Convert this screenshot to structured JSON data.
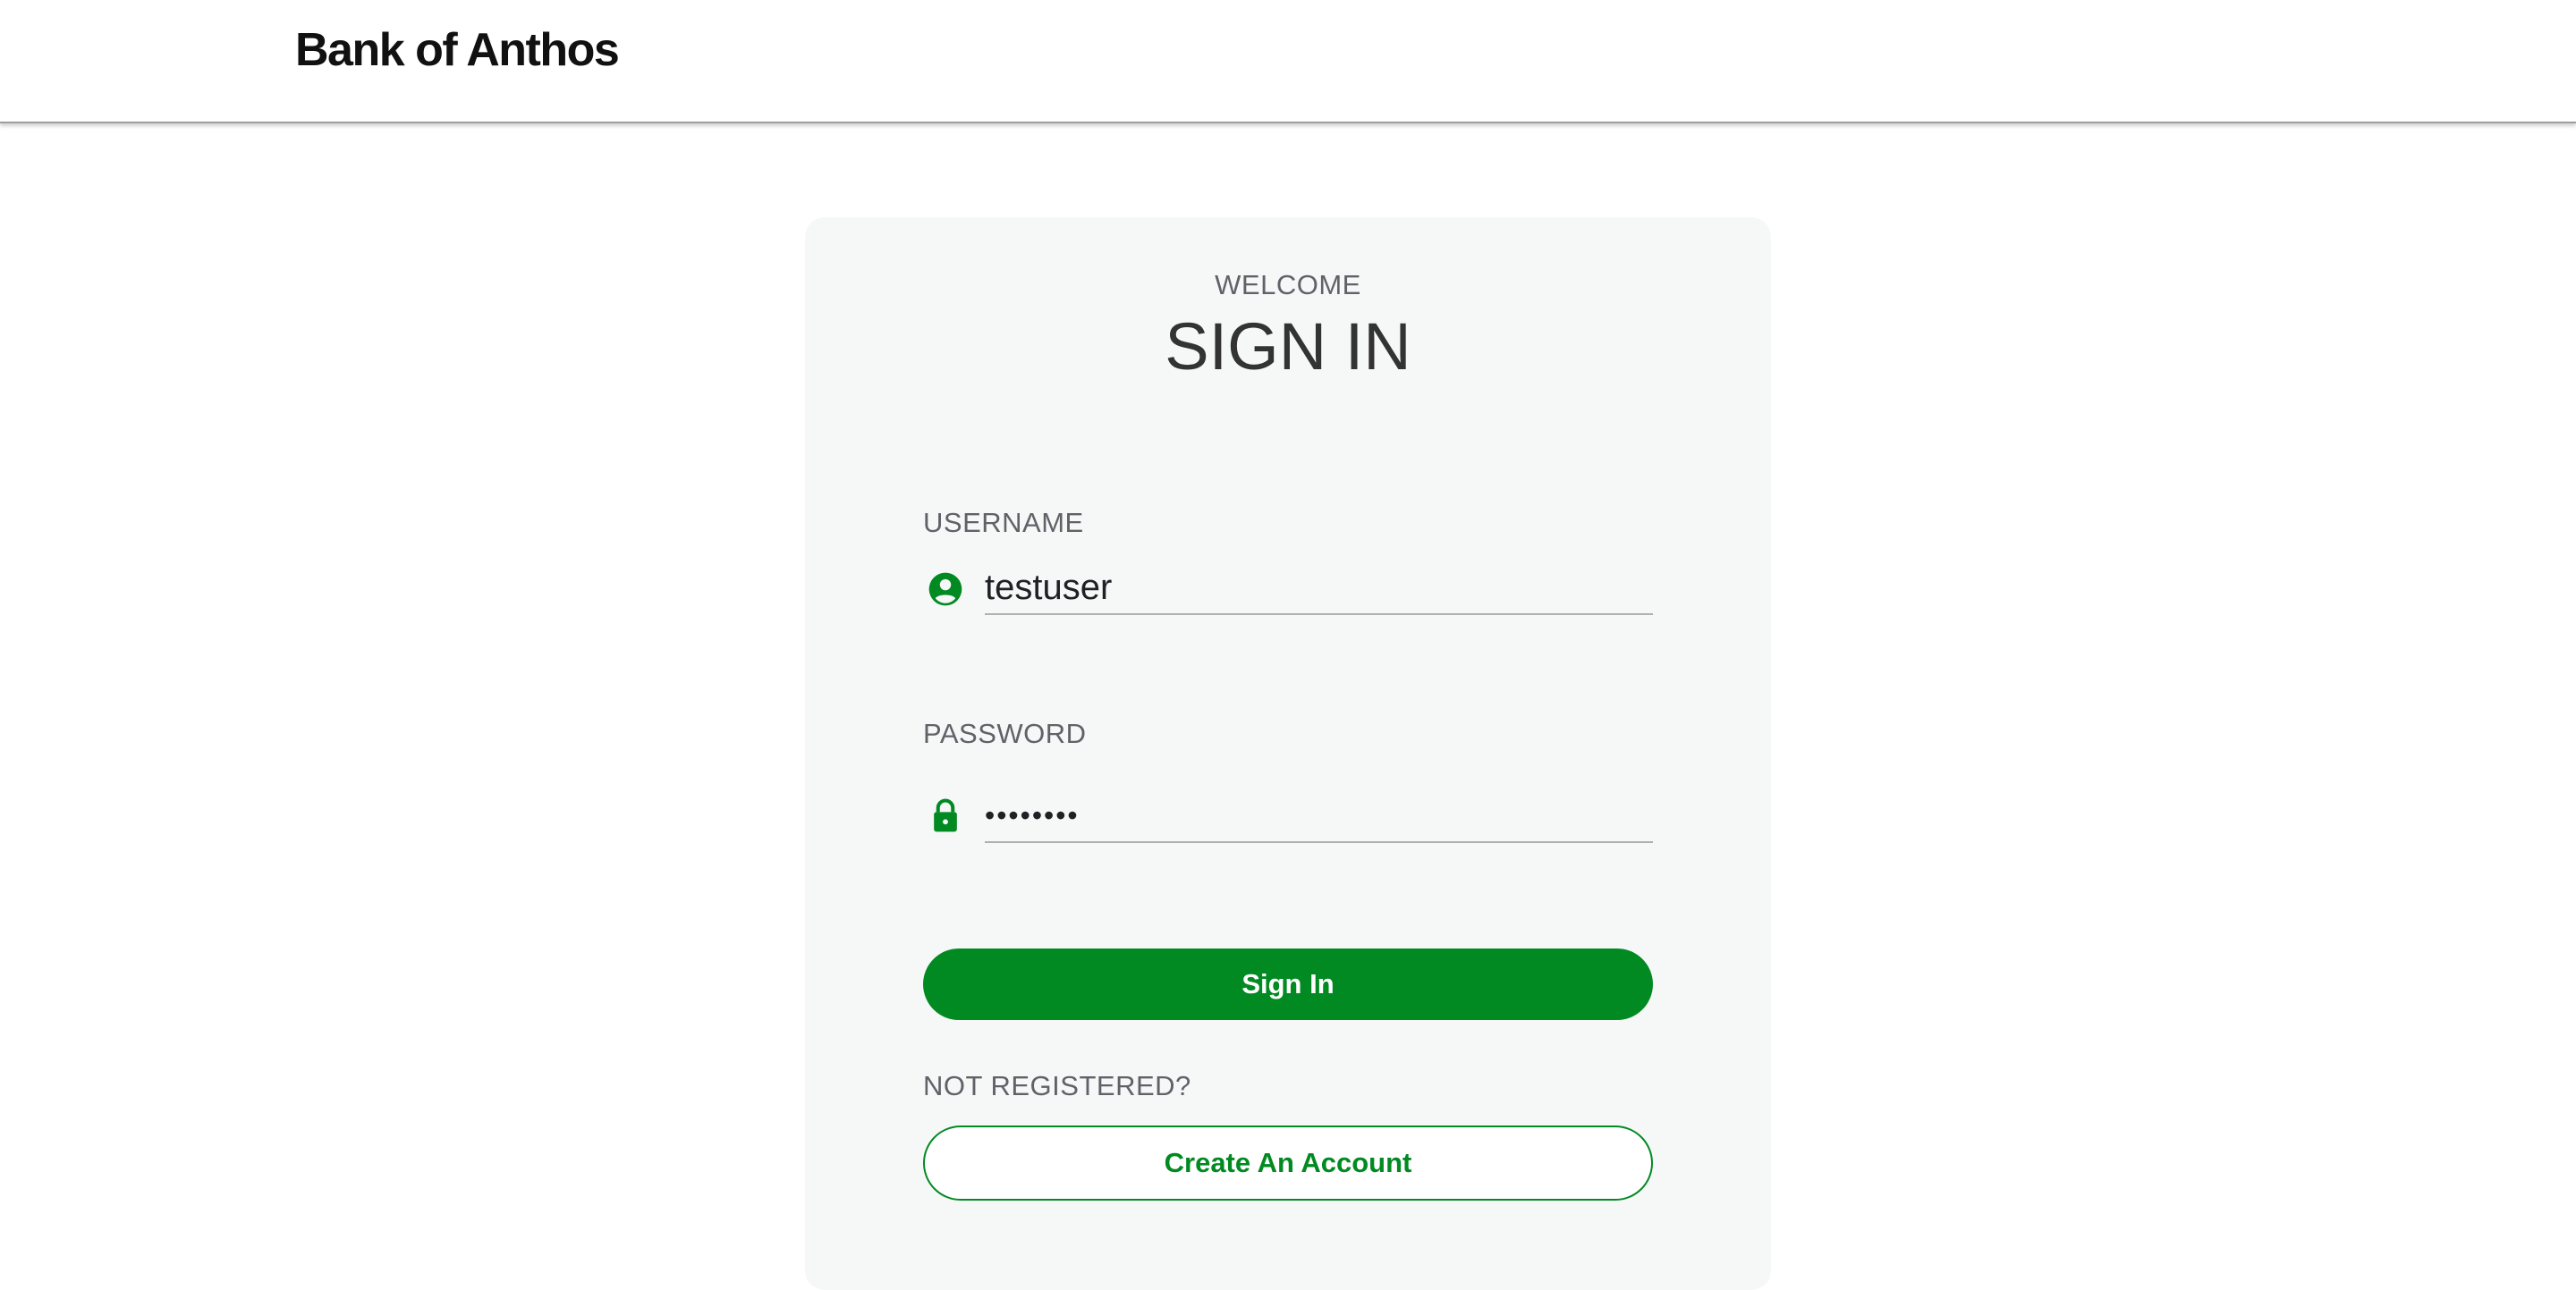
{
  "header": {
    "brand": "Bank of Anthos"
  },
  "login": {
    "welcome": "WELCOME",
    "title": "SIGN IN",
    "username": {
      "label": "USERNAME",
      "value": "testuser",
      "icon": "account-circle-icon"
    },
    "password": {
      "label": "PASSWORD",
      "value": "password",
      "icon": "lock-icon"
    },
    "signin_button": "Sign In",
    "not_registered": "NOT REGISTERED?",
    "create_account_button": "Create An Account"
  },
  "colors": {
    "accent": "#028a22",
    "card_background": "#f6f7f7",
    "label": "#5f6368"
  }
}
